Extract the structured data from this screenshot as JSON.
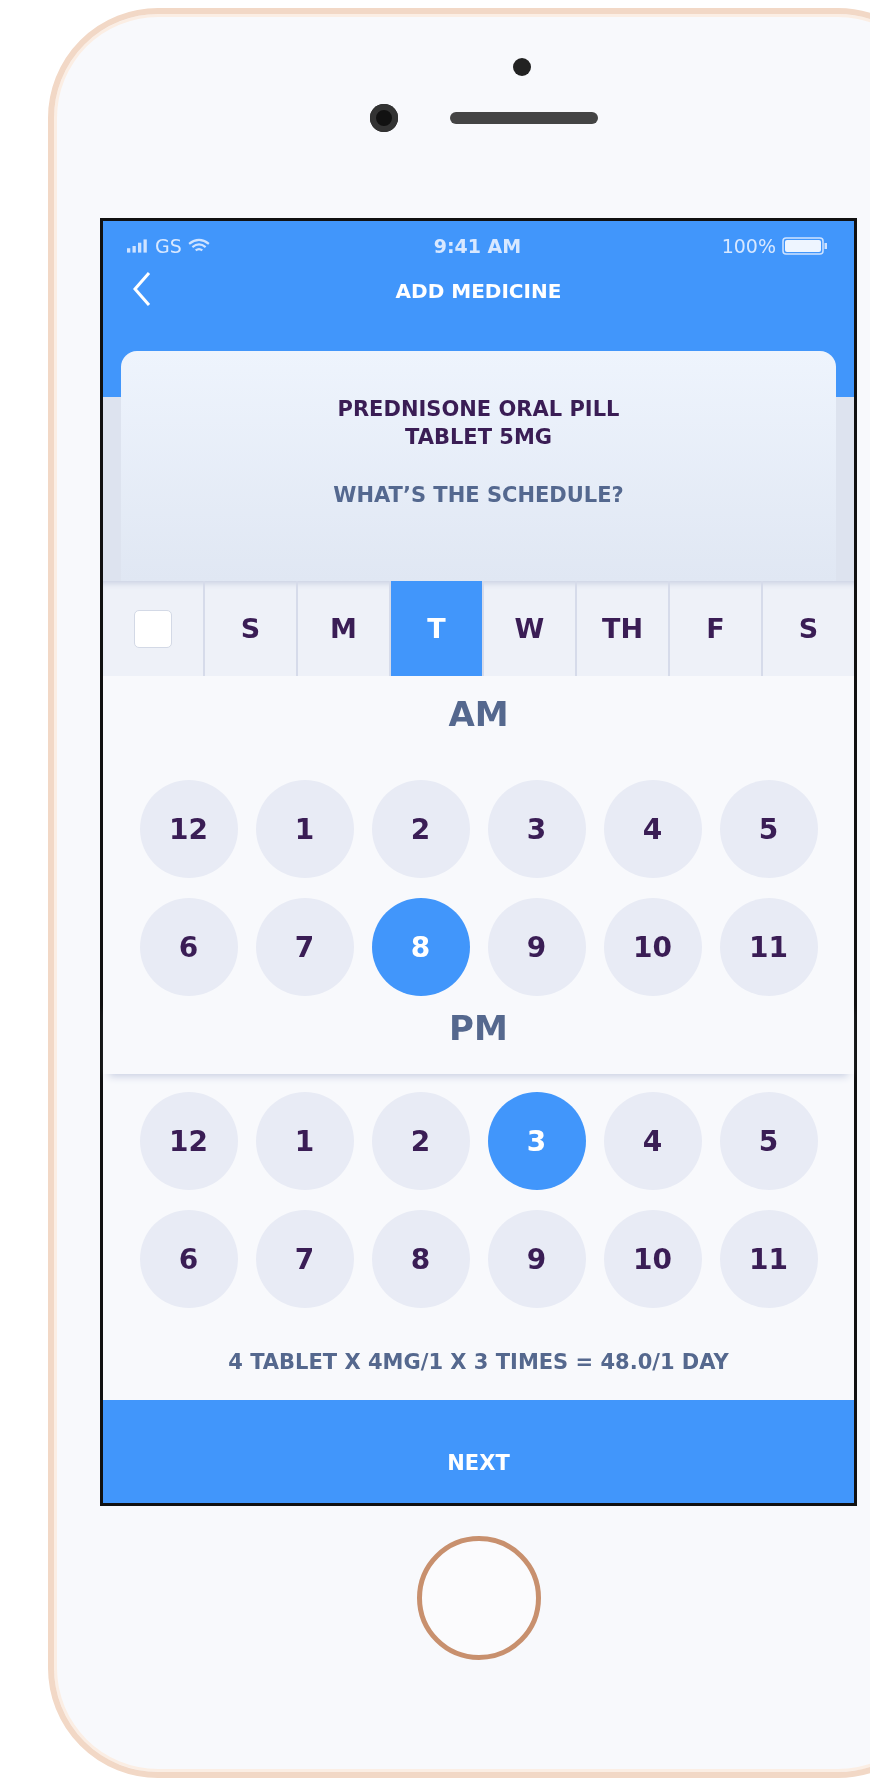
{
  "status_bar": {
    "carrier": "GS",
    "time": "9:41 AM",
    "battery": "100%"
  },
  "header": {
    "title": "ADD MEDICINE"
  },
  "card": {
    "medicine_lines": [
      "PREDNISONE ORAL PILL",
      "TABLET 5MG"
    ],
    "question": "WHAT’S THE SCHEDULE?"
  },
  "day_picker": {
    "all_checkbox": {
      "checked": false
    },
    "days": [
      {
        "label": "S",
        "selected": false
      },
      {
        "label": "M",
        "selected": false
      },
      {
        "label": "T",
        "selected": true
      },
      {
        "label": "W",
        "selected": false
      },
      {
        "label": "TH",
        "selected": false
      },
      {
        "label": "F",
        "selected": false
      },
      {
        "label": "S",
        "selected": false
      }
    ]
  },
  "periods": [
    {
      "label": "AM",
      "hours": [
        {
          "label": "12",
          "selected": false
        },
        {
          "label": "1",
          "selected": false
        },
        {
          "label": "2",
          "selected": false
        },
        {
          "label": "3",
          "selected": false
        },
        {
          "label": "4",
          "selected": false
        },
        {
          "label": "5",
          "selected": false
        },
        {
          "label": "6",
          "selected": false
        },
        {
          "label": "7",
          "selected": false
        },
        {
          "label": "8",
          "selected": true
        },
        {
          "label": "9",
          "selected": false
        },
        {
          "label": "10",
          "selected": false
        },
        {
          "label": "11",
          "selected": false
        }
      ]
    },
    {
      "label": "PM",
      "hours": [
        {
          "label": "12",
          "selected": false
        },
        {
          "label": "1",
          "selected": false
        },
        {
          "label": "2",
          "selected": false
        },
        {
          "label": "3",
          "selected": true
        },
        {
          "label": "4",
          "selected": false
        },
        {
          "label": "5",
          "selected": false
        },
        {
          "label": "6",
          "selected": false
        },
        {
          "label": "7",
          "selected": false
        },
        {
          "label": "8",
          "selected": false
        },
        {
          "label": "9",
          "selected": false
        },
        {
          "label": "10",
          "selected": false
        },
        {
          "label": "11",
          "selected": false
        }
      ]
    }
  ],
  "summary": "4 TABLET X 4MG/1 X 3 TIMES = 48.0/1 DAY",
  "next_button": "NEXT"
}
